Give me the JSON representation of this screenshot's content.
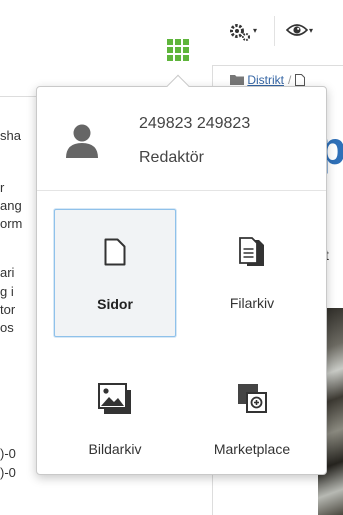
{
  "toolbar": {
    "apps_icon": "app-grid-icon",
    "settings_icon": "gears-icon",
    "view_icon": "eye-icon",
    "caret": "▾"
  },
  "breadcrumb": {
    "folder_icon": "folder-icon",
    "item": "Distrikt",
    "separator": "/"
  },
  "background_fragments": [
    "sha",
    "r",
    "ang",
    "orm",
    "ari",
    "g i",
    "tor",
    " os",
    ")-0",
    ")-0"
  ],
  "right_fragments": {
    "blue_text": "p",
    "t_text": "t"
  },
  "popup": {
    "user": {
      "avatar_icon": "user-icon",
      "name": "249823 249823",
      "role": "Redaktör"
    },
    "apps": [
      {
        "label": "Sidor",
        "icon": "page-icon",
        "active": true
      },
      {
        "label": "Filarkiv",
        "icon": "file-archive-icon",
        "active": false
      },
      {
        "label": "Bildarkiv",
        "icon": "image-archive-icon",
        "active": false
      },
      {
        "label": "Marketplace",
        "icon": "marketplace-icon",
        "active": false
      }
    ]
  },
  "colors": {
    "apps_green": "#5fb53c",
    "link_blue": "#3465a4",
    "active_border": "#8fc1ea",
    "active_bg": "#f1f3f5",
    "brand_blue": "#2f70b8"
  }
}
